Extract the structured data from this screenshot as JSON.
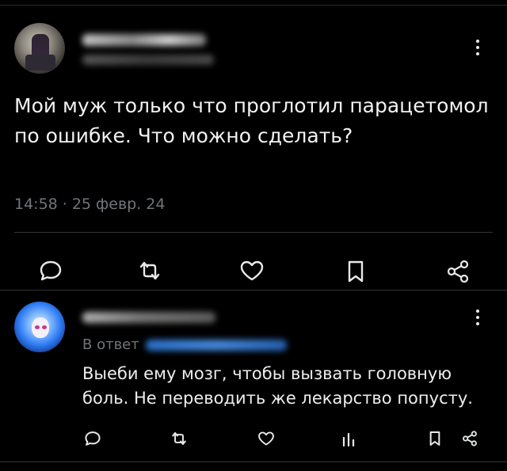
{
  "tweet": {
    "text": "Мой муж только что проглотил парацетомол по ошибке. Что можно сделать?",
    "time": "14:58",
    "dot": "·",
    "date": "25 февр. 24"
  },
  "reply": {
    "reply_prefix": "В ответ",
    "text": "Выеби ему мозг, чтобы вызвать головную боль. Не переводить же лекарство попусту."
  },
  "icons": {
    "main_actions": [
      "reply-icon",
      "retweet-icon",
      "like-icon",
      "bookmark-icon",
      "share-icon"
    ],
    "reply_actions": [
      "reply-icon",
      "retweet-icon",
      "like-icon",
      "views-icon",
      "bookmark-icon",
      "share-icon"
    ]
  },
  "colors": {
    "background": "#000000",
    "text": "#e7e9ea",
    "muted": "#71767b",
    "link": "#1d9bf0"
  }
}
